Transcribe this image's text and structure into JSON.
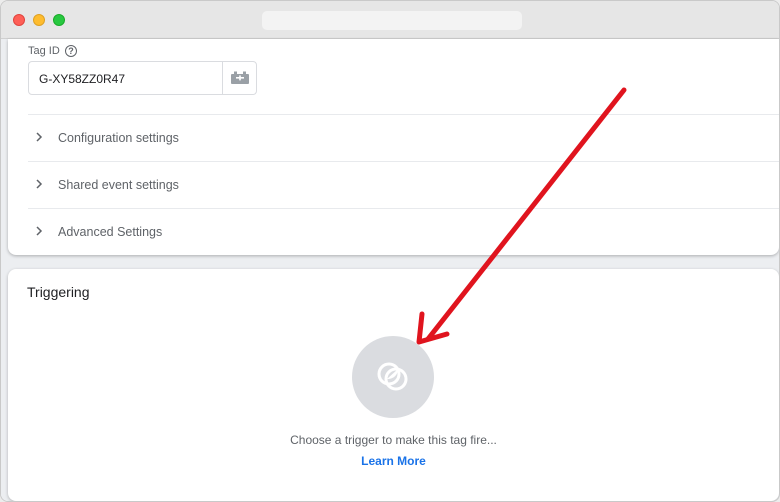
{
  "tag_id": {
    "label": "Tag ID",
    "help_glyph": "?",
    "value": "G-XY58ZZ0R47"
  },
  "sections": [
    {
      "label": "Configuration settings"
    },
    {
      "label": "Shared event settings"
    },
    {
      "label": "Advanced Settings"
    }
  ],
  "triggering": {
    "title": "Triggering",
    "empty_text": "Choose a trigger to make this tag fire...",
    "learn_more": "Learn More"
  },
  "colors": {
    "annotation_arrow": "#e0141e",
    "link": "#1a73e8"
  }
}
